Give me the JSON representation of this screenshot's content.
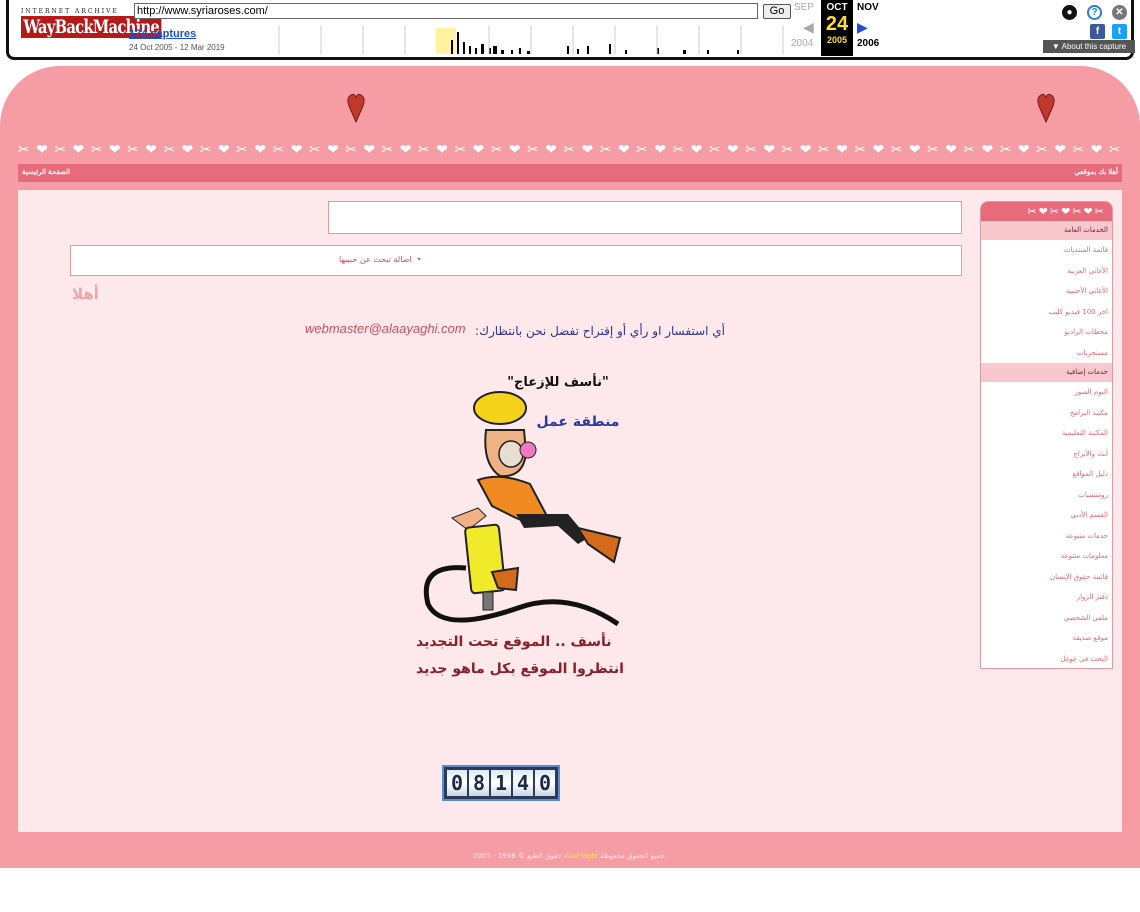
{
  "wayback": {
    "logo_top": "INTERNET ARCHIVE",
    "logo": "WayBackMachine",
    "url": "http://www.syriaroses.com/",
    "go_label": "Go",
    "captures": "174 captures",
    "range": "24 Oct 2005 - 12 Mar 2019",
    "prev_month": "SEP",
    "cur_month": "OCT",
    "next_month": "NOV",
    "prev_year": "2004",
    "cur_day": "24",
    "cur_year": "2005",
    "next_year": "2006",
    "about": "About this capture"
  },
  "site": {
    "nav_right": "أهلا بك بموقعي",
    "nav_left": "الصفحة الرئيسية",
    "news_item": "اصالة تبحث عن حبيبها",
    "greeting": "أهلا",
    "contact_text": "أي استفسار او رأي أو إقتراح تفضل نحن بانتظارك:",
    "email": "webmaster@alaayaghi.com",
    "sign_sorry": "\"نأسف للإزعاج\"",
    "sign_work": "منطقة عمل",
    "sorry_line1": "نأسف .. الموقع تحت التجديد",
    "sorry_line2": "انتظروا الموقع بكل ماهو جديد",
    "counter": "08140",
    "footer_pre": "حقوق الطبع © 1998 - 2005",
    "footer_brand": "AlaaYaghi",
    "footer_post": "جميع الحقوق محفوظة."
  },
  "sidebar": {
    "section1": "الخدمات العامة",
    "items1": [
      "قائمة المنتديات",
      "الأغاني العربية",
      "الأغاني الأجنبية",
      "اخر 100 فيديو كليب",
      "محطات الراديو",
      "مسنجريات"
    ],
    "section2": "خدمات إضافية",
    "items2": [
      "البوم الصور",
      "مكتبة البرامج",
      "المكتبة التعليمية",
      "أنت والأبراج",
      "دليل المواقع",
      "رومنسيات",
      "القسم الأدبي",
      "خدمات متنوعة",
      "معلومات متنوعة",
      "قائمة حقوق الإنسان",
      "دفتر الزوار",
      "ملفي الشخصي",
      "موقع صديقة",
      "البحث في غوغل"
    ]
  },
  "colors": {
    "page_pink": "#f59ca5",
    "content_bg": "#fde9ec",
    "nav_bar": "#e86b7b"
  }
}
